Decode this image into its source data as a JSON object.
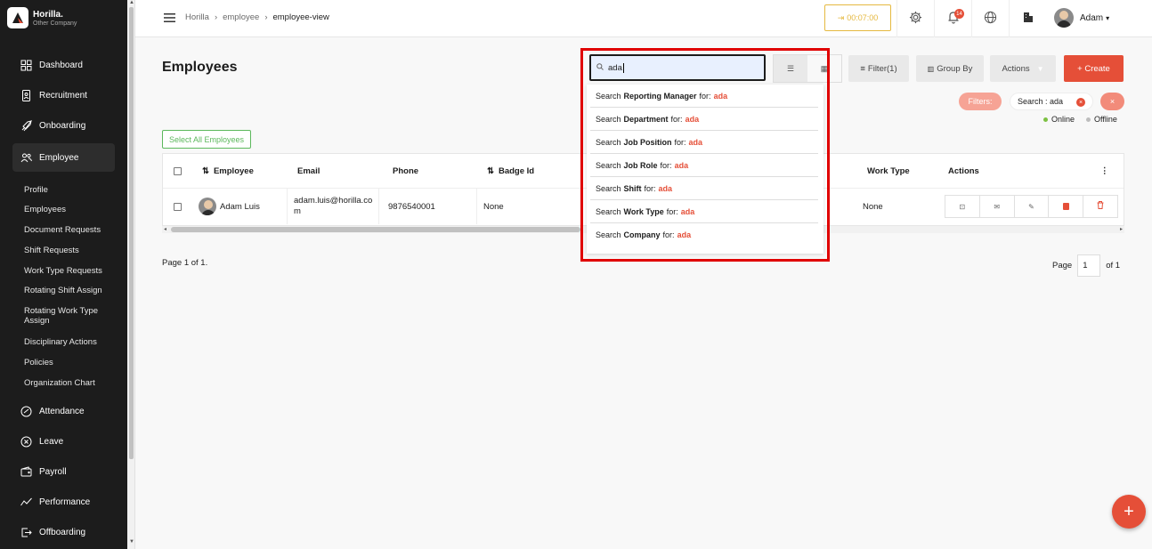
{
  "brand": {
    "name": "Horilla.",
    "company": "Other Company"
  },
  "nav": [
    {
      "label": "Dashboard",
      "icon": "dashboard-icon"
    },
    {
      "label": "Recruitment",
      "icon": "recruitment-icon"
    },
    {
      "label": "Onboarding",
      "icon": "onboarding-icon"
    },
    {
      "label": "Employee",
      "icon": "employee-icon",
      "active": true
    },
    {
      "label": "Attendance",
      "icon": "attendance-icon"
    },
    {
      "label": "Leave",
      "icon": "leave-icon"
    },
    {
      "label": "Payroll",
      "icon": "payroll-icon"
    },
    {
      "label": "Performance",
      "icon": "performance-icon"
    },
    {
      "label": "Offboarding",
      "icon": "offboarding-icon"
    }
  ],
  "employee_submenu": [
    "Profile",
    "Employees",
    "Document Requests",
    "Shift Requests",
    "Work Type Requests",
    "Rotating Shift Assign",
    "Rotating Work Type Assign",
    "Disciplinary Actions",
    "Policies",
    "Organization Chart"
  ],
  "breadcrumb": [
    "Horilla",
    "employee",
    "employee-view"
  ],
  "timer": "00:07:00",
  "notifications_count": "14",
  "user": {
    "name": "Adam"
  },
  "page_title": "Employees",
  "search": {
    "value": "ada"
  },
  "toolbar": {
    "filter": "Filter(1)",
    "group_by": "Group By",
    "actions": "Actions",
    "create": "+ Create"
  },
  "filters": {
    "label": "Filters:",
    "chip": "Search : ada",
    "clear": "×"
  },
  "legend": {
    "online": "Online",
    "offline": "Offline"
  },
  "select_all": "Select All Employees",
  "table": {
    "headers": {
      "employee": "Employee",
      "email": "Email",
      "phone": "Phone",
      "badge": "Badge Id",
      "work_type": "Work Type",
      "actions": "Actions"
    },
    "rows": [
      {
        "employee": "Adam Luis",
        "email": "adam.luis@horilla.com",
        "phone": "9876540001",
        "badge": "None",
        "work_type": "None"
      }
    ]
  },
  "dropdown": [
    {
      "prefix": "Search",
      "field": "Reporting Manager",
      "suffix": "for:",
      "query": "ada"
    },
    {
      "prefix": "Search",
      "field": "Department",
      "suffix": "for:",
      "query": "ada"
    },
    {
      "prefix": "Search",
      "field": "Job Position",
      "suffix": "for:",
      "query": "ada"
    },
    {
      "prefix": "Search",
      "field": "Job Role",
      "suffix": "for:",
      "query": "ada"
    },
    {
      "prefix": "Search",
      "field": "Shift",
      "suffix": "for:",
      "query": "ada"
    },
    {
      "prefix": "Search",
      "field": "Work Type",
      "suffix": "for:",
      "query": "ada"
    },
    {
      "prefix": "Search",
      "field": "Company",
      "suffix": "for:",
      "query": "ada"
    }
  ],
  "pagination": {
    "summary": "Page 1 of 1.",
    "page_label": "Page",
    "current": "1",
    "of": "of 1"
  },
  "colors": {
    "accent": "#e54f38",
    "highlight": "#e00000",
    "sidebar": "#1c1c1c",
    "online": "#7cc142",
    "offline": "#bdbdbd"
  }
}
